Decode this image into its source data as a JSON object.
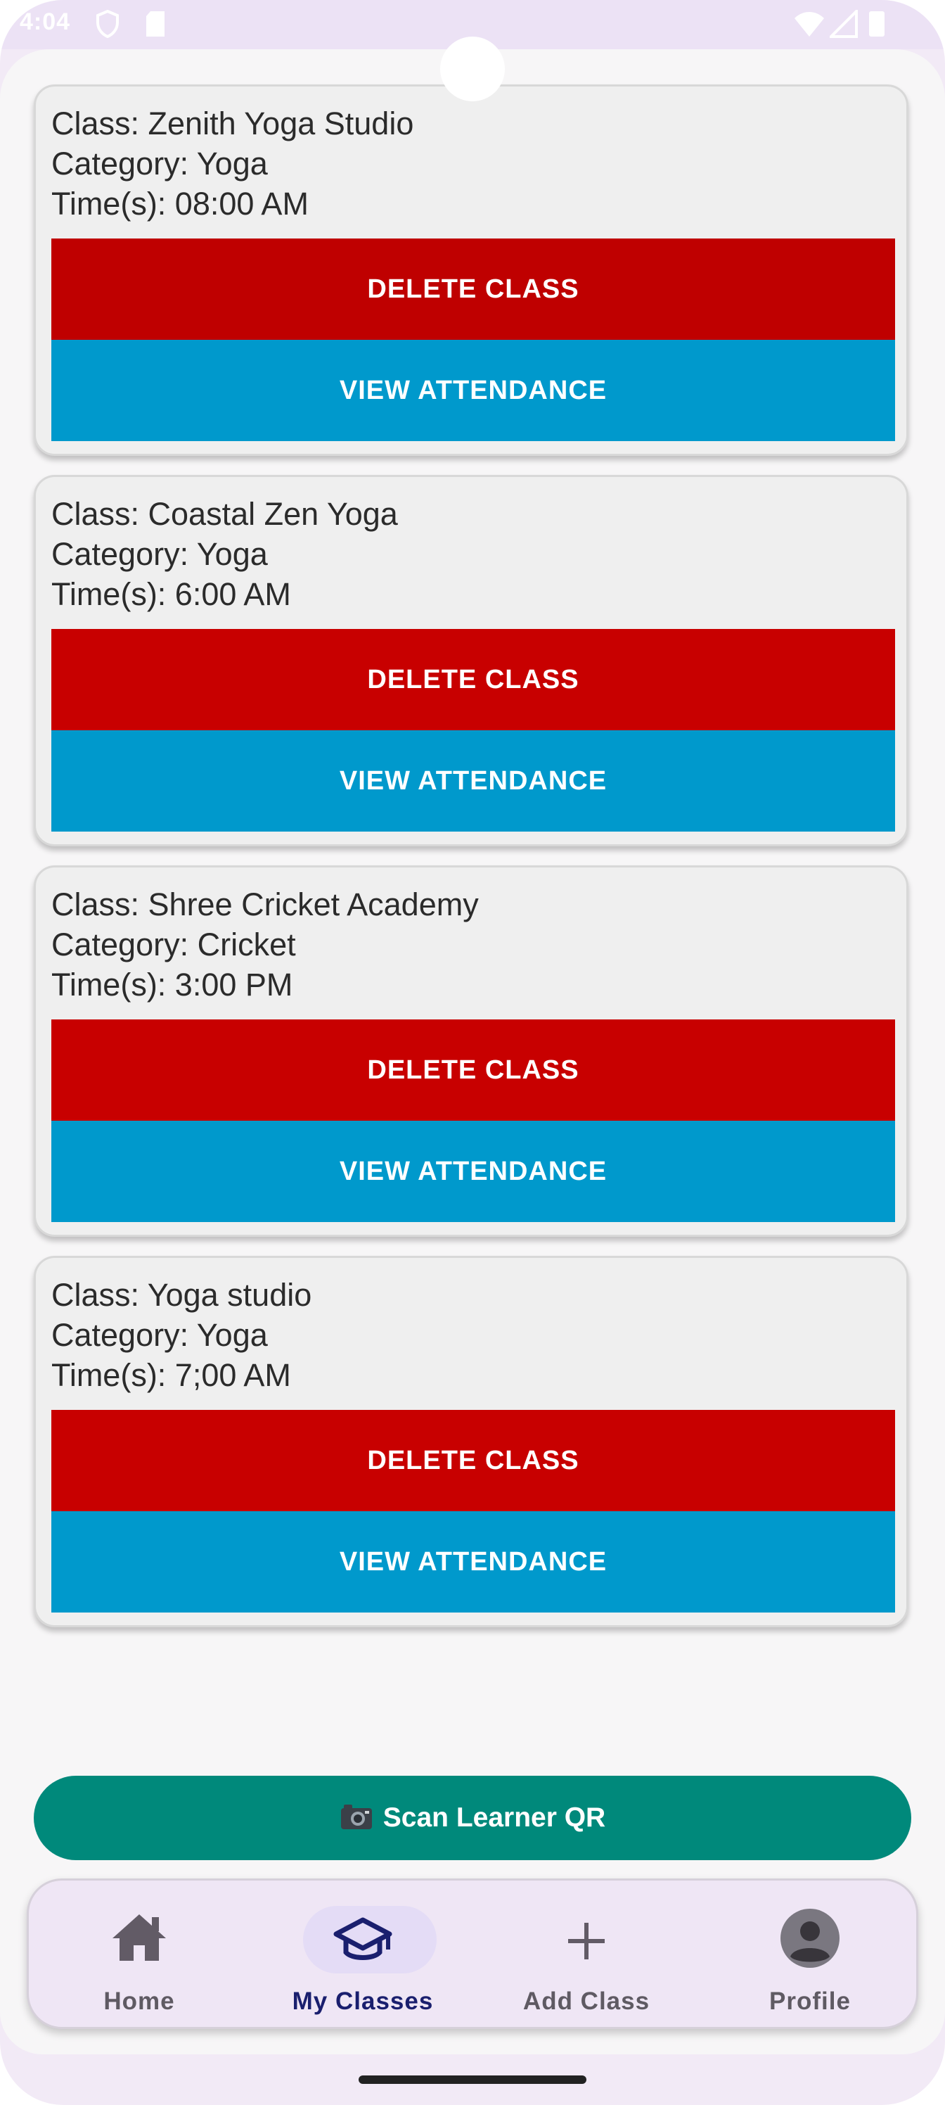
{
  "status_bar": {
    "time": "4:04"
  },
  "classes": [
    {
      "name": "Class: Zenith Yoga Studio",
      "category": "Category: Yoga",
      "times": "Time(s): 08:00 AM",
      "delete_label": "DELETE CLASS",
      "attendance_label": "VIEW ATTENDANCE"
    },
    {
      "name": "Class: Coastal Zen Yoga",
      "category": "Category: Yoga",
      "times": "Time(s): 6:00 AM",
      "delete_label": "DELETE CLASS",
      "attendance_label": "VIEW ATTENDANCE"
    },
    {
      "name": "Class: Shree Cricket Academy",
      "category": "Category: Cricket",
      "times": "Time(s): 3:00 PM",
      "delete_label": "DELETE CLASS",
      "attendance_label": "VIEW ATTENDANCE"
    },
    {
      "name": "Class: Yoga studio",
      "category": "Category: Yoga",
      "times": "Time(s): 7;00 AM",
      "delete_label": "DELETE CLASS",
      "attendance_label": "VIEW ATTENDANCE"
    }
  ],
  "scan_button": {
    "icon": "camera-icon",
    "label": "Scan Learner QR"
  },
  "bottom_nav": {
    "active": "My Classes",
    "items": [
      {
        "label": "Home",
        "icon": "home-icon"
      },
      {
        "label": "My Classes",
        "icon": "graduation-cap-icon"
      },
      {
        "label": "Add Class",
        "icon": "plus-icon"
      },
      {
        "label": "Profile",
        "icon": "person-icon"
      }
    ]
  },
  "colors": {
    "delete": "#c50000",
    "attendance": "#0099cc",
    "scan": "#00897b",
    "nav_active": "#1a1f6e",
    "nav_inactive": "#5f5a63",
    "nav_active_pill": "#e4dcf6"
  }
}
